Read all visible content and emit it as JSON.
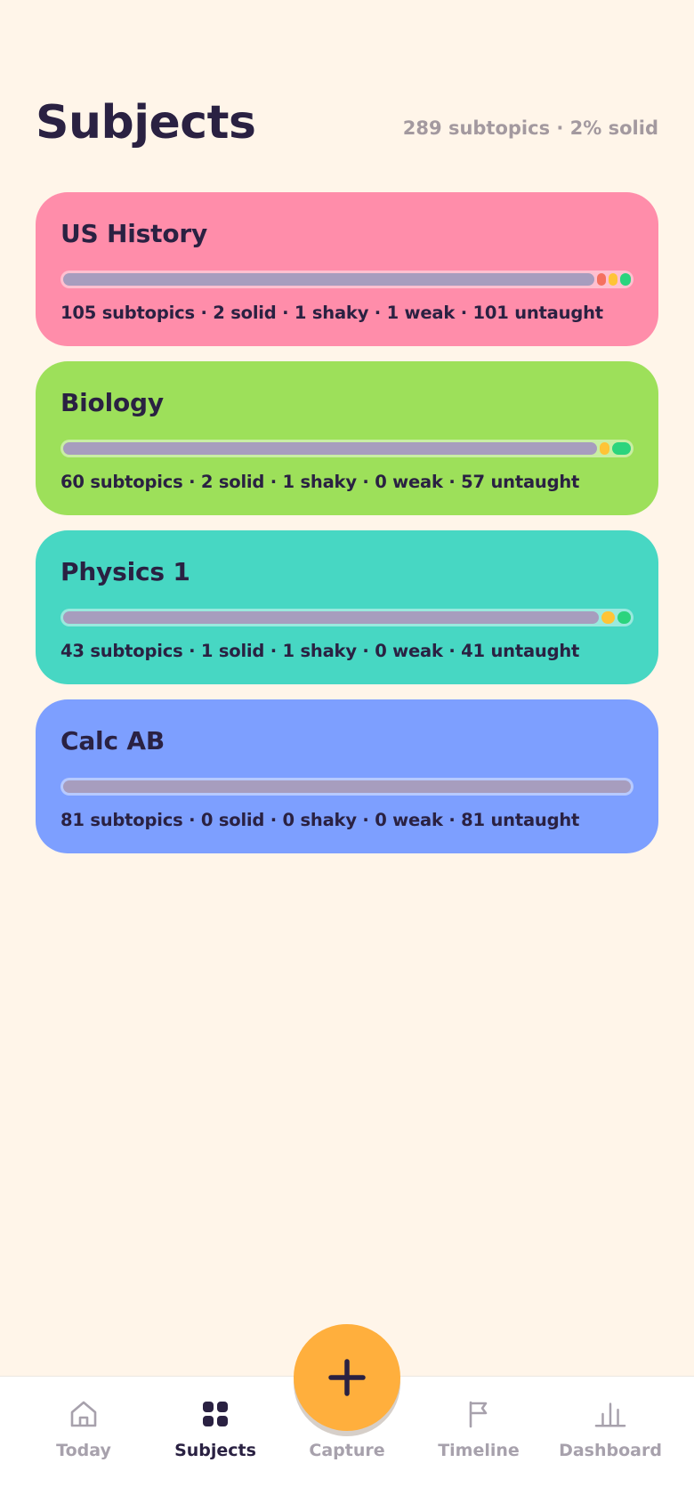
{
  "header": {
    "title": "Subjects",
    "summary": "289 subtopics · 2% solid"
  },
  "colors": {
    "background": "#FFF5E9",
    "text": "#2A2142",
    "untaught": "#A79DBE",
    "weak": "#F5705F",
    "shaky": "#FFC436",
    "solid": "#2BD47D",
    "capture_button": "#FFAF3D"
  },
  "subjects": [
    {
      "name": "US History",
      "color": "#FF8DAA",
      "stats": "105 subtopics · 2 solid · 1 shaky · 1 weak · 101 untaught",
      "total": 105,
      "solid": 2,
      "shaky": 1,
      "weak": 1,
      "untaught": 101
    },
    {
      "name": "Biology",
      "color": "#9DE05A",
      "stats": "60 subtopics · 2 solid · 1 shaky · 0 weak · 57 untaught",
      "total": 60,
      "solid": 2,
      "shaky": 1,
      "weak": 0,
      "untaught": 57
    },
    {
      "name": "Physics 1",
      "color": "#47D7C3",
      "stats": "43 subtopics · 1 solid · 1 shaky · 0 weak · 41 untaught",
      "total": 43,
      "solid": 1,
      "shaky": 1,
      "weak": 0,
      "untaught": 41
    },
    {
      "name": "Calc AB",
      "color": "#7D9FFF",
      "stats": "81 subtopics · 0 solid · 0 shaky · 0 weak · 81 untaught",
      "total": 81,
      "solid": 0,
      "shaky": 0,
      "weak": 0,
      "untaught": 81
    }
  ],
  "capture_button": {
    "icon": "plus-icon"
  },
  "nav": {
    "active": "subjects",
    "items": [
      {
        "key": "today",
        "label": "Today",
        "icon": "home-icon"
      },
      {
        "key": "subjects",
        "label": "Subjects",
        "icon": "grid-icon"
      },
      {
        "key": "capture",
        "label": "Capture",
        "icon": "plus-icon"
      },
      {
        "key": "timeline",
        "label": "Timeline",
        "icon": "flag-icon"
      },
      {
        "key": "dashboard",
        "label": "Dashboard",
        "icon": "bar-chart-icon"
      }
    ]
  }
}
